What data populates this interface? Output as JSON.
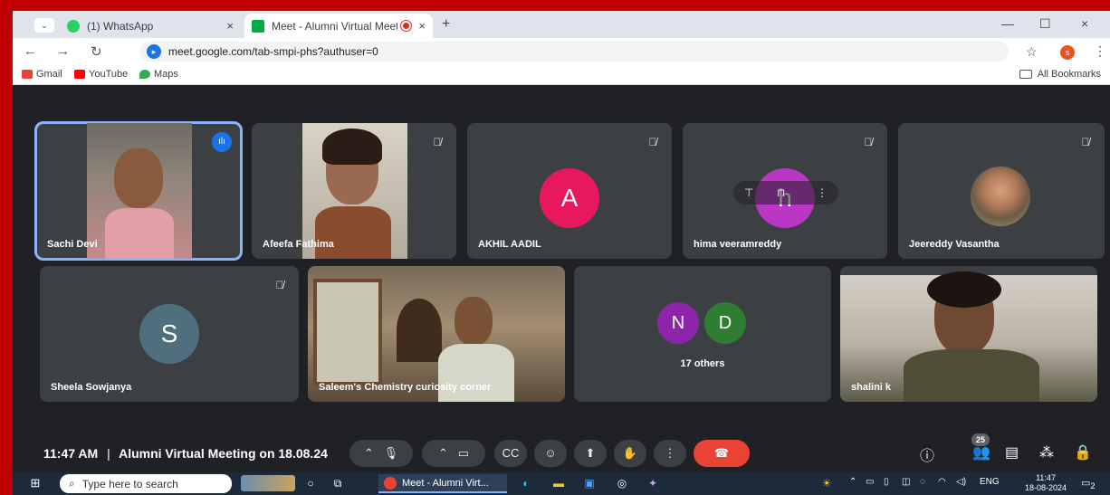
{
  "browser": {
    "tabs": [
      {
        "label": "(1) WhatsApp",
        "close": "×"
      },
      {
        "label": "Meet - Alumni Virtual Meet",
        "close": "×"
      }
    ],
    "new_tab": "+",
    "window_controls": {
      "minimize": "—",
      "maximize": "☐",
      "close": "×"
    },
    "url": "meet.google.com/tab-smpi-phs?authuser=0",
    "profile_initial": "s",
    "bookmarks": [
      "Gmail",
      "YouTube",
      "Maps"
    ],
    "all_bookmarks": "All Bookmarks"
  },
  "meet": {
    "row1": [
      {
        "name": "Sachi Devi",
        "type": "video",
        "speaking": true
      },
      {
        "name": "Afeefa Fathima",
        "type": "video"
      },
      {
        "name": "AKHIL AADIL",
        "type": "avatar",
        "initial": "A",
        "color": "#e8185e"
      },
      {
        "name": "hima veeramreddy",
        "type": "avatar",
        "initial": "h",
        "color": "#b937c4"
      },
      {
        "name": "Jeereddy Vasantha",
        "type": "photo"
      }
    ],
    "row2": [
      {
        "name": "Sheela Sowjanya",
        "type": "avatar",
        "initial": "S",
        "color": "#4f6f7f"
      },
      {
        "name": "Saleem's Chemistry curiosity corner",
        "type": "video"
      },
      {
        "name": "17 others",
        "type": "others",
        "initials": [
          "N",
          "D"
        ],
        "colors": [
          "#8e24aa",
          "#2e7d32"
        ]
      },
      {
        "name": "shalini k",
        "type": "video"
      }
    ],
    "clock": "11:47 AM",
    "separator": "|",
    "meeting_title": "Alumni Virtual Meeting on 18.08.24",
    "people_count": "25"
  },
  "taskbar": {
    "search_placeholder": "Type here to search",
    "active_app": "Meet - Alumni Virt...",
    "lang": "ENG",
    "time": "11:47",
    "date": "18-08-2024",
    "notifications": "2"
  },
  "colors": {
    "frame": "#c00000",
    "meet_bg": "#202124",
    "tile": "#3c4043",
    "end_call": "#ea4335",
    "accent": "#1a73e8"
  }
}
